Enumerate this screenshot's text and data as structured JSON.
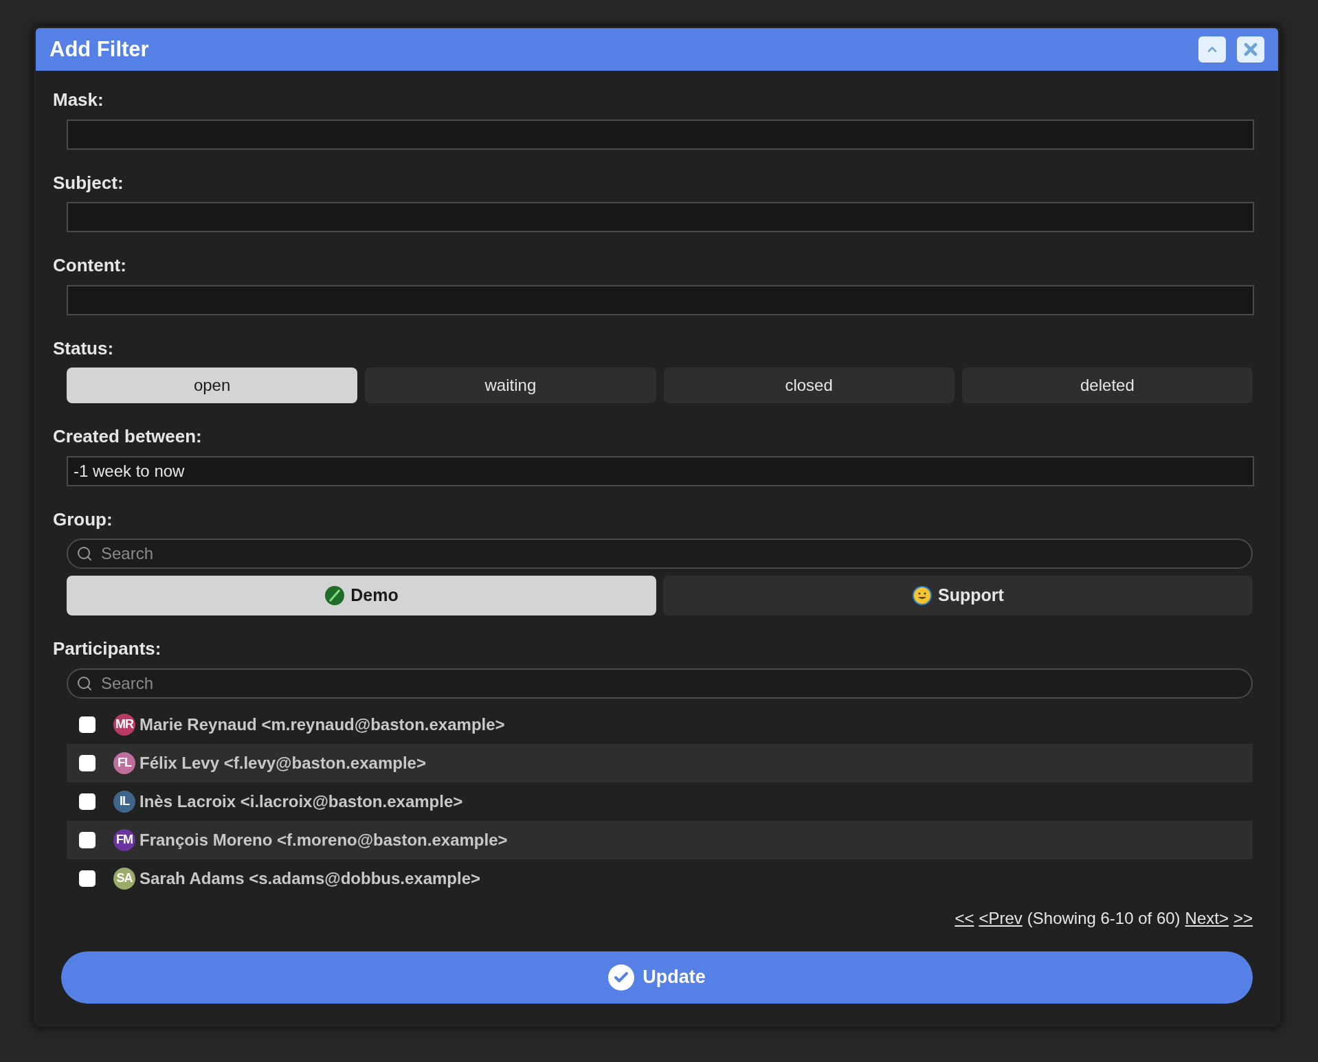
{
  "window": {
    "title": "Add Filter"
  },
  "fields": [
    {
      "label": "Mask:"
    },
    {
      "label": "Subject:"
    },
    {
      "label": "Content:"
    }
  ],
  "status": {
    "label": "Status:",
    "options": [
      {
        "label": "open",
        "selected": true
      },
      {
        "label": "waiting",
        "selected": false
      },
      {
        "label": "closed",
        "selected": false
      },
      {
        "label": "deleted",
        "selected": false
      }
    ]
  },
  "created": {
    "label": "Created between:",
    "value": "-1 week to now"
  },
  "group": {
    "label": "Group:",
    "search_placeholder": "Search",
    "options": [
      {
        "label": "Demo",
        "selected": true,
        "kind": "pen"
      },
      {
        "label": "Support",
        "selected": false,
        "kind": "smiley"
      }
    ]
  },
  "participants": {
    "label": "Participants:",
    "search_placeholder": "Search",
    "rows": [
      {
        "initials": "MR",
        "color": "#b83b62",
        "text": "Marie Reynaud <m.reynaud@baston.example>",
        "checked": false
      },
      {
        "initials": "FL",
        "color": "#c06e9c",
        "text": "Félix Levy <f.levy@baston.example>",
        "checked": false
      },
      {
        "initials": "IL",
        "color": "#3f6688",
        "text": "Inès Lacroix <i.lacroix@baston.example>",
        "checked": false
      },
      {
        "initials": "FM",
        "color": "#6b34a3",
        "text": "François Moreno <f.moreno@baston.example>",
        "checked": false
      },
      {
        "initials": "SA",
        "color": "#9aab6a",
        "text": "Sarah Adams <s.adams@dobbus.example>",
        "checked": false
      }
    ],
    "pagination": {
      "first": "<<",
      "prev": "<Prev",
      "summary": "(Showing 6-10 of 60)",
      "next": "Next>",
      "last": ">>"
    }
  },
  "update_button": "Update"
}
